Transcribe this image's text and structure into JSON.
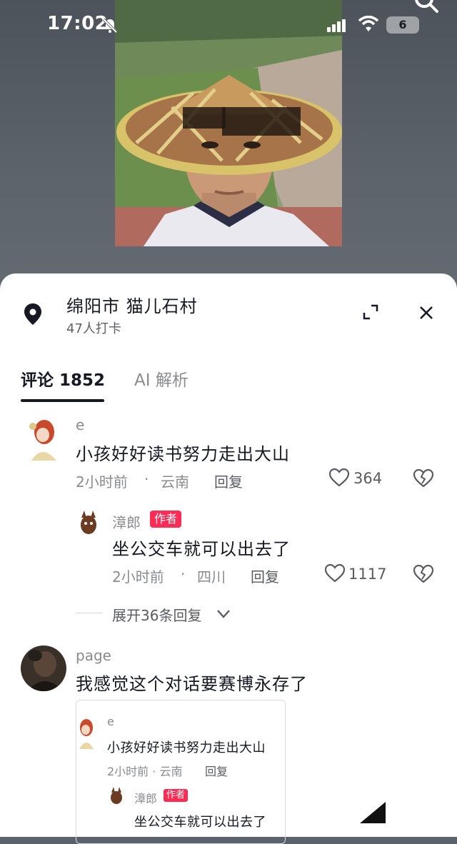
{
  "status_bar": {
    "time": "17:02",
    "battery": "6",
    "icons": [
      "bell-slash-icon",
      "cellular-signal-icon",
      "wifi-icon",
      "battery-icon",
      "search-icon"
    ]
  },
  "location": {
    "name": "绵阳市  猫儿石村",
    "checkins": "47人打卡"
  },
  "tabs": [
    {
      "label": "评论 1852",
      "active": true
    },
    {
      "label": "AI 解析",
      "active": false
    }
  ],
  "comments": [
    {
      "user": "e",
      "text": "小孩好好读书努力走出大山",
      "time": "2小时前",
      "region": "云南",
      "reply_label": "回复",
      "likes": "364",
      "replies": [
        {
          "user": "漳郎",
          "badge": "作者",
          "text": "坐公交车就可以出去了",
          "time": "2小时前",
          "region": "四川",
          "reply_label": "回复",
          "likes": "1117"
        }
      ],
      "expand_label": "展开36条回复"
    },
    {
      "user": "page",
      "text": "我感觉这个对话要赛博永存了",
      "quote": {
        "user": "e",
        "text": "小孩好好读书努力走出大山",
        "meta": "2小时前 · 云南",
        "reply_label": "回复",
        "reply_user": "漳郎",
        "reply_badge": "作者",
        "reply_text": "坐公交车就可以出去了"
      }
    }
  ],
  "separator": "·",
  "colors": {
    "accent": "#fe2c55",
    "text": "#161823",
    "muted": "#8a8b91"
  }
}
